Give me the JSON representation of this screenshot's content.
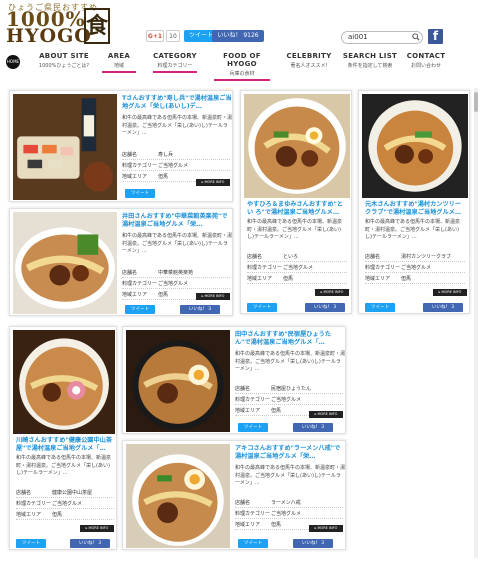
{
  "header": {
    "logo_kana": "ひょうご県民おすすめ",
    "logo_line1": "1000%",
    "logo_line2": "HYOGO",
    "logo_kanji": "食",
    "gplus_label": "G+1",
    "gplus_count": "10",
    "tweet_label": "ツイート",
    "fb_like_label": "いいね！ 9126",
    "search_value": "ai001"
  },
  "nav": [
    {
      "en": "ABOUT SITE",
      "ja": "1000%ひょうごとは?"
    },
    {
      "en": "AREA",
      "ja": "地域"
    },
    {
      "en": "CATEGORY",
      "ja": "料理カテゴリー"
    },
    {
      "en": "FOOD OF HYOGO",
      "ja": "兵庫の食材"
    },
    {
      "en": "CELEBRITY",
      "ja": "著名人オススメ!"
    },
    {
      "en": "SEARCH LIST",
      "ja": "条件を指定して検索"
    },
    {
      "en": "CONTACT",
      "ja": "お問い合わせ"
    }
  ],
  "labels": {
    "store": "店舗名",
    "category": "料理カテゴリー",
    "area": "地域エリア",
    "more": "MORE INFO",
    "tweet": "ツイート",
    "like": "いいね！ 3"
  },
  "cards": [
    {
      "title": "Tさんおすすめ\"寿し兵\"で湯村温泉ご当地グルメ「栄し(あいし)デ…",
      "desc": "和牛の最高峰である但馬牛の本場、新温泉町・湯村温泉。ご当地グルメ「栄し(あい)し)テールラーメン」…",
      "store": "寿し兵",
      "category": "ご当地グルメ",
      "area": "但馬"
    },
    {
      "title": "やすひろ＆まゆみさんおすすめ\"とい ろ\"で湯村温泉ご当地グルメ…",
      "desc": "和牛の最高峰である但馬牛の本場、新温泉町・湯村温泉。ご当地グルメ「栄し(あい)し)テールラーメン」…",
      "store": "といろ",
      "category": "ご当地グルメ",
      "area": "但馬"
    },
    {
      "title": "元木さんおすすめ\"湯村カンツリークラブ\"で湯村温泉ご当地グルメ…",
      "desc": "和牛の最高峰である但馬牛の本場、新温泉町・湯村温泉。ご当地グルメ「栄し(あい)し)テールラーメン」…",
      "store": "湯村カンツリークラブ",
      "category": "ご当地グルメ",
      "area": "但馬"
    },
    {
      "title": "井田さんおすすめ\"中華菜館英楽苑\"で湯村温泉ご当地グルメ「栄…",
      "desc": "和牛の最高峰である但馬牛の本場、新温泉町・湯村温泉。ご当地グルメ「栄し(あい)し)テールラーメン」…",
      "store": "中華菜館英楽苑",
      "category": "ご当地グルメ",
      "area": "但馬"
    },
    {
      "title": "田中さんおすすめ\"民宿屋ひょうたん\"で湯村温泉ご当地グルメ「…",
      "desc": "和牛の最高峰である但馬牛の本場、新温泉町・湯村温泉。ご当地グルメ「栄し(あい)し)テールラーメン」…",
      "store": "民宿屋ひょうたん",
      "category": "ご当地グルメ",
      "area": "但馬"
    },
    {
      "title": "川崎さんおすすめ\"健康公園中山茶屋\"で湯村温泉ご当地グルメ「…",
      "desc": "和牛の最高峰である但馬牛の本場、新温泉町・湯村温泉。ご当地グルメ「栄し(あい)し)テールラーメン」…",
      "store": "健康公園中山茶屋",
      "category": "ご当地グルメ",
      "area": "但馬"
    },
    {
      "title": "アキコさんおすすめ\"ラーメン八戒\"で湯村温泉ご当地グルメ「栄…",
      "desc": "和牛の最高峰である但馬牛の本場、新温泉町・湯村温泉。ご当地グルメ「栄し(あい)し)テールラーメン」…",
      "store": "ラーメン八戒",
      "category": "ご当地グルメ",
      "area": "但馬"
    }
  ],
  "colors": {
    "accent": "#d4237a",
    "link": "#1a8fd6",
    "twitter": "#1da1f2",
    "facebook": "#4267b2"
  }
}
